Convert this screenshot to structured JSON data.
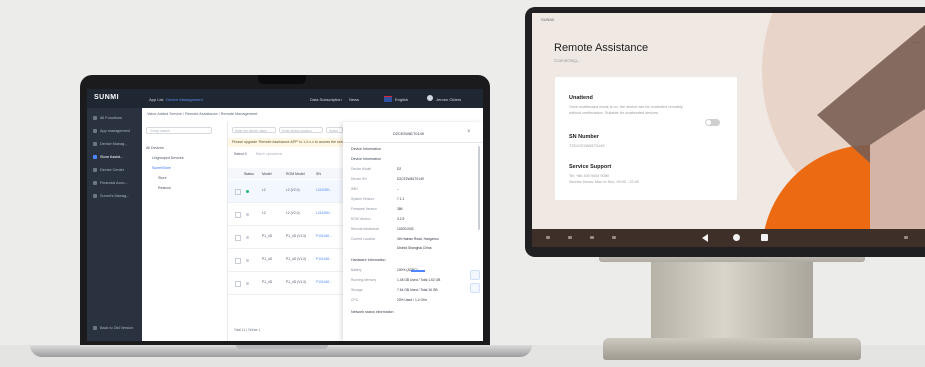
{
  "laptop": {
    "brand": "SUNMI",
    "topbar": {
      "items": [
        "App List",
        "Device Management",
        "Data Subscription",
        "News",
        "English",
        "Jeroen Olders"
      ],
      "active_index": 1
    },
    "sidebar": {
      "items": [
        "All Functions",
        "App management",
        "Device Manag...",
        "Store Assist...",
        "Device Center",
        "Financial Acco...",
        "Sunmi's Manag..."
      ],
      "active_index": 3,
      "footer": "Back to Old Version"
    },
    "breadcrumb": "Value Added Service / Remote Assistance / Remote Management",
    "tree": {
      "search_placeholder": "Group search",
      "nodes": [
        "All Devices",
        "Ungrouped Devices",
        "SunmiStore",
        "Store",
        "Restock"
      ],
      "selected_index": 2
    },
    "filters": [
      "Enter the device name",
      "Enter device location",
      "Select"
    ],
    "notice": "Please upgrade 'Remote Assistance APP' to 1.0.x.x to access the service",
    "select_label": "Select 0",
    "select_hint": "Batch operations",
    "table": {
      "columns": [
        "Status",
        "Model",
        "ROM Model",
        "SN"
      ],
      "rows": [
        {
          "online": true,
          "model": "L2",
          "rom": "L2 (V2.0)",
          "sn": "L24105H..."
        },
        {
          "online": false,
          "model": "L2",
          "rom": "L2 (V2.0)",
          "sn": "L24105H..."
        },
        {
          "online": false,
          "model": "P1_4G",
          "rom": "P1_4G (V1.0)",
          "sn": "P101168..."
        },
        {
          "online": false,
          "model": "P1_4G",
          "rom": "P1_4G (V1.0)",
          "sn": "P101168..."
        },
        {
          "online": false,
          "model": "P1_4G",
          "rom": "P1_4G (V1.0)",
          "sn": "P101168..."
        }
      ],
      "total": "Total 11 | Online 1"
    },
    "drawer": {
      "title": "D2CE2W81T0149",
      "tab": "Device Information",
      "section_device": "Device Information",
      "device": [
        {
          "k": "Device Model",
          "v": "D2"
        },
        {
          "k": "Device SN",
          "v": "D2CE2W81T0149"
        },
        {
          "k": "IMEI",
          "v": "--"
        },
        {
          "k": "System Version",
          "v": "7.1.1"
        },
        {
          "k": "Firmware Version",
          "v": "386"
        },
        {
          "k": "ROM Version",
          "v": "3.2.9"
        },
        {
          "k": "Remote Assistance",
          "v": "102001003"
        },
        {
          "k": "Current Location",
          "v": "3th Hainan Road, Hangzhou"
        },
        {
          "k": "",
          "v": "District,Shanghai,China"
        }
      ],
      "section_hardware": "Hardware Information",
      "hardware": [
        {
          "k": "Battery",
          "v": "100%   (ADPC)"
        },
        {
          "k": "Running Memory",
          "v": "1.48 GB Used / Total 1.62 GB"
        },
        {
          "k": "Storage",
          "v": "7.64 GB Used / Total 16 GB"
        },
        {
          "k": "CPU",
          "v": "20% Used / 1.4 GHz"
        }
      ],
      "battery_level": 0.6,
      "section_network": "Network status information"
    }
  },
  "tablet": {
    "status_brand": "SUNMI",
    "title": "Remote Assistance",
    "subtitle": "Connecting...",
    "unattend": {
      "heading": "Unattend",
      "desc_1": "Once unattended mode is on, the device can be controlled remotely",
      "desc_2": "without confirmation. Suitable for unattended devices.",
      "toggle_on": false
    },
    "sn": {
      "heading": "SN Number",
      "value": "T2SXCE2W81T0149"
    },
    "support": {
      "heading": "Service Support",
      "phone": "Tel: +86 400 9004 9089",
      "hours": "Service Hours: Mon to Sun, 09:00 - 22:00"
    },
    "accent_color": "#ec6a12",
    "art_colors": [
      "#ec6a12",
      "#ddbfb2",
      "#7a5e53"
    ]
  }
}
